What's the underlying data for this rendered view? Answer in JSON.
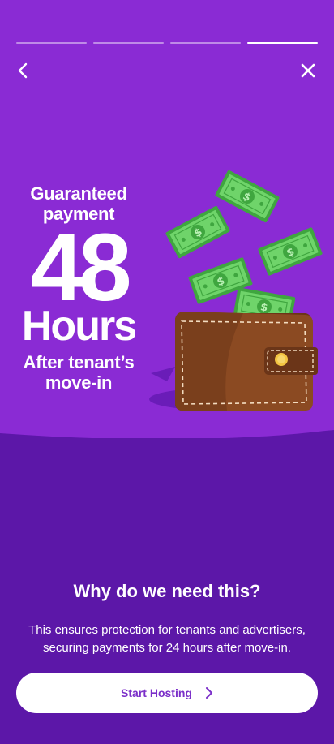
{
  "progress": {
    "total_steps": 4,
    "current_step": 4
  },
  "nav": {
    "back_icon": "chevron-left-icon",
    "close_icon": "close-icon"
  },
  "hero": {
    "line1": "Guaranteed",
    "line2": "payment",
    "big_number": "48",
    "big_unit": "Hours",
    "line3": "After tenant’s",
    "line4": "move-in"
  },
  "info": {
    "title": "Why do we need this?",
    "description": "This ensures protection for tenants and advertisers, securing payments for 24 hours after move-in."
  },
  "cta": {
    "label": "Start Hosting",
    "icon": "chevron-right-icon"
  },
  "colors": {
    "hero_bg": "#8a2bd4",
    "lower_bg": "#5c17a8",
    "button_bg": "#ffffff",
    "button_text": "#7b2fc9",
    "money_green": "#5bc75a",
    "wallet_brown": "#8b4a22"
  }
}
